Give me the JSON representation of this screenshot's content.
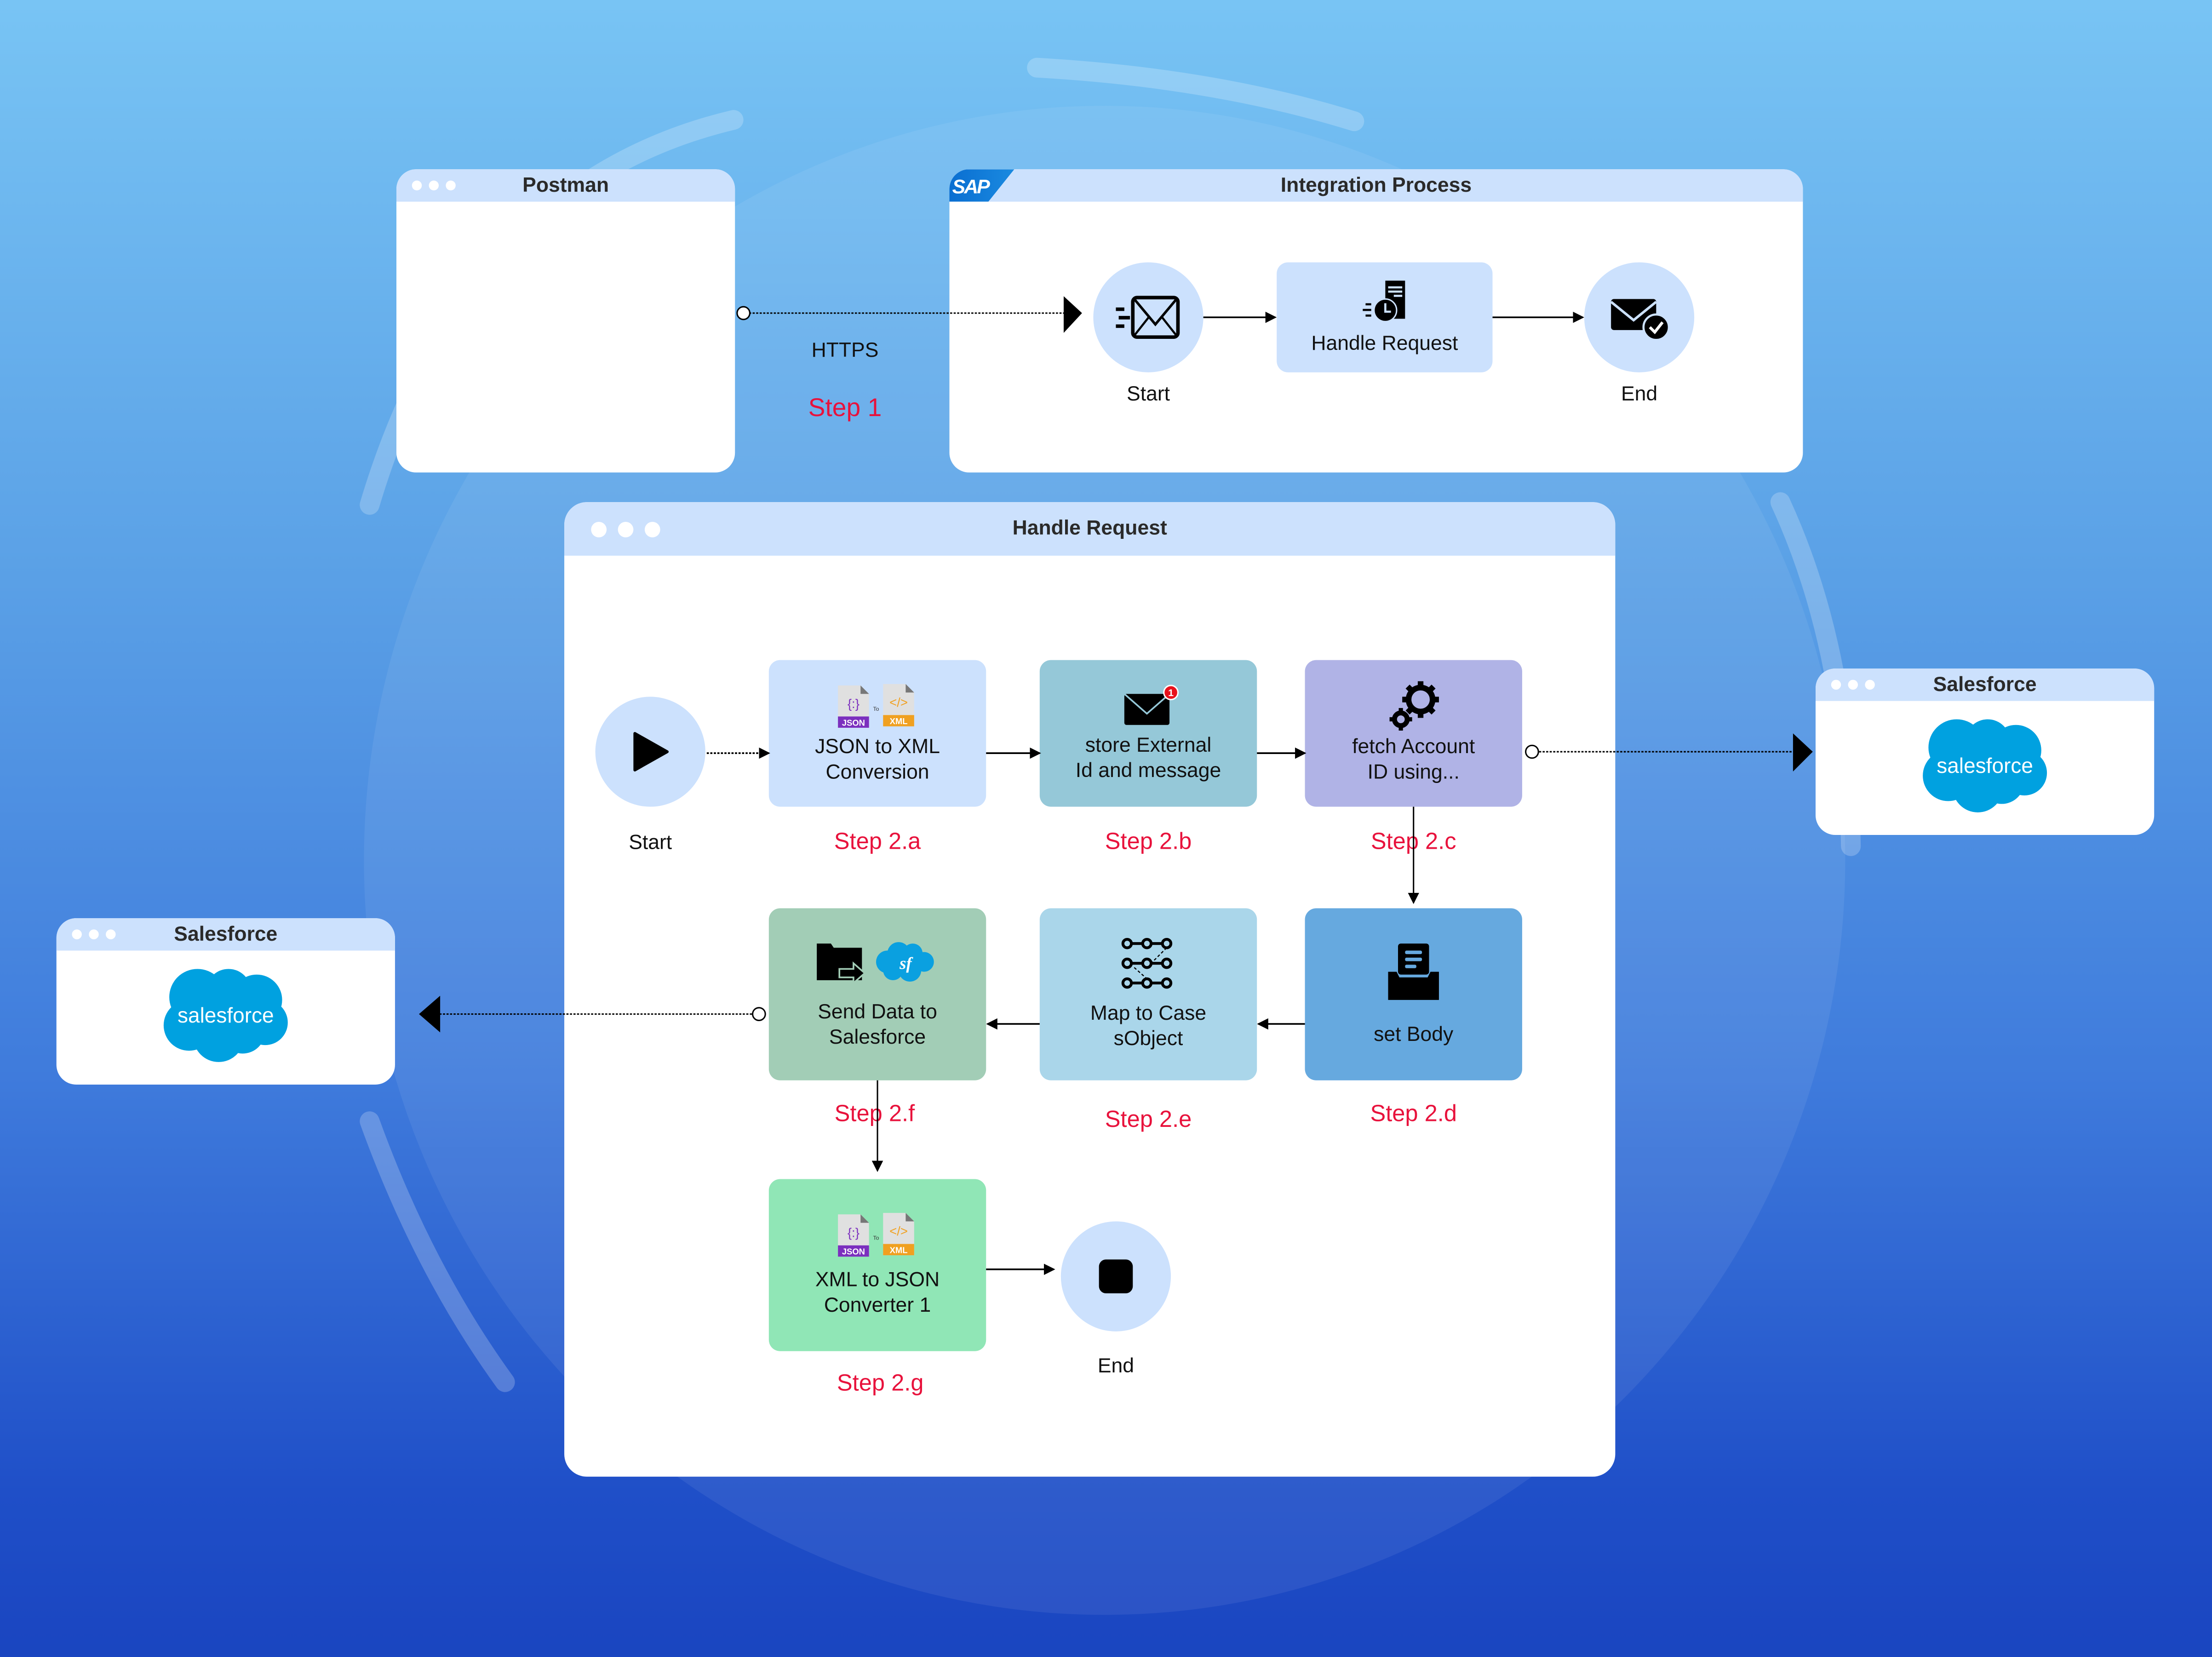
{
  "colors": {
    "window_header": "#cce1fd",
    "step_label": "#e8123c",
    "salesforce_blue": "#00a1e0",
    "node_2a": "#cce1fd",
    "node_2b": "#95c8d8",
    "node_2c": "#b0b3e6",
    "node_2d": "#66a9df",
    "node_2e": "#aad6ea",
    "node_2f": "#a2cdb6",
    "node_2g": "#90e6b6"
  },
  "postman": {
    "title": "Postman"
  },
  "connection": {
    "protocol": "HTTPS",
    "step": "Step 1"
  },
  "integration_process": {
    "title": "Integration Process",
    "logo": "SAP",
    "start_label": "Start",
    "handle_request_label": "Handle Request",
    "end_label": "End",
    "icons": {
      "start": "envelope-send-icon",
      "handle": "timer-document-icon",
      "end": "envelope-check-icon"
    }
  },
  "handle_request": {
    "title": "Handle Request",
    "start_label": "Start",
    "end_label": "End",
    "nodes": [
      {
        "id": "2a",
        "label_line1": "JSON to XML",
        "label_line2": "Conversion",
        "step": "Step 2.a",
        "icon": "json-to-xml-icon"
      },
      {
        "id": "2b",
        "label_line1": "store External",
        "label_line2": "Id and message",
        "step": "Step 2.b",
        "icon": "envelope-notification-icon",
        "badge": "1"
      },
      {
        "id": "2c",
        "label_line1": "fetch Account",
        "label_line2": "ID using...",
        "step": "Step 2.c",
        "icon": "gears-icon"
      },
      {
        "id": "2d",
        "label_line1": "set Body",
        "label_line2": "",
        "step": "Step 2.d",
        "icon": "inbox-tray-icon"
      },
      {
        "id": "2e",
        "label_line1": "Map to Case",
        "label_line2": "sObject",
        "step": "Step 2.e",
        "icon": "mapping-icon"
      },
      {
        "id": "2f",
        "label_line1": "Send Data to",
        "label_line2": "Salesforce",
        "step": "Step 2.f",
        "icon": "folder-send-salesforce-icon",
        "sf_text": "sf"
      },
      {
        "id": "2g",
        "label_line1": "XML to JSON",
        "label_line2": "Converter 1",
        "step": "Step 2.g",
        "icon": "json-to-xml-icon"
      }
    ],
    "converter_icon": {
      "json_text": "JSON",
      "xml_text": "XML",
      "to_text": "To",
      "json_glyph": "{:}",
      "xml_glyph": "</>"
    }
  },
  "salesforce_right": {
    "title": "Salesforce",
    "logo_text": "salesforce"
  },
  "salesforce_left": {
    "title": "Salesforce",
    "logo_text": "salesforce"
  }
}
